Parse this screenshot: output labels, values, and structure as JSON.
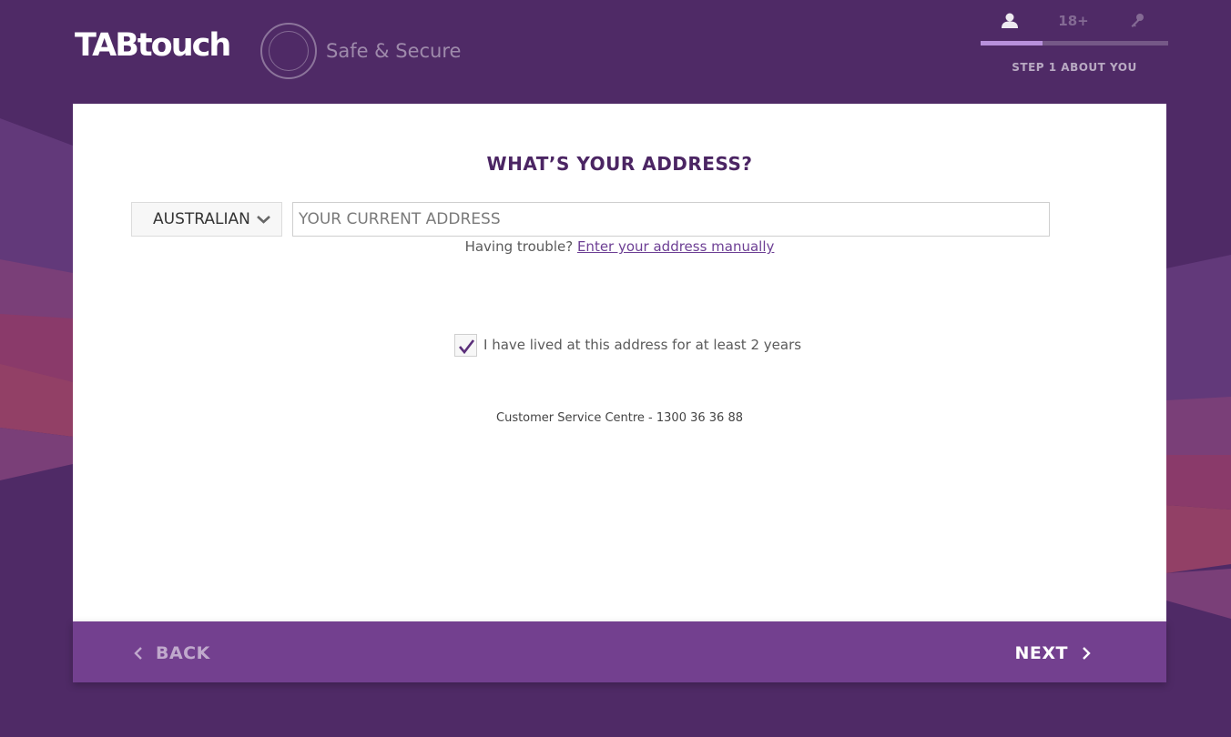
{
  "header": {
    "logo_text": "TABtouch",
    "tagline": "Safe & Secure",
    "steps": {
      "age_icon_text": "18+",
      "current_label": "STEP 1 ABOUT YOU",
      "progress_fraction": 0.33
    }
  },
  "form": {
    "title": "WHAT’S YOUR ADDRESS?",
    "country_select": {
      "value": "AUSTRALIAN"
    },
    "address_input": {
      "placeholder": "YOUR CURRENT ADDRESS",
      "value": ""
    },
    "help_prefix": "Having trouble?",
    "help_link": "Enter your address manually",
    "lived_checkbox": {
      "label": "I have lived at this address for at least 2 years",
      "checked": true
    },
    "service_text": "Customer Service Centre - 1300 36 36 88"
  },
  "nav": {
    "back_label": "BACK",
    "next_label": "NEXT"
  },
  "colors": {
    "background": "#4f2a66",
    "accent": "#73408f",
    "title": "#4b2563",
    "link": "#6d3f94"
  }
}
